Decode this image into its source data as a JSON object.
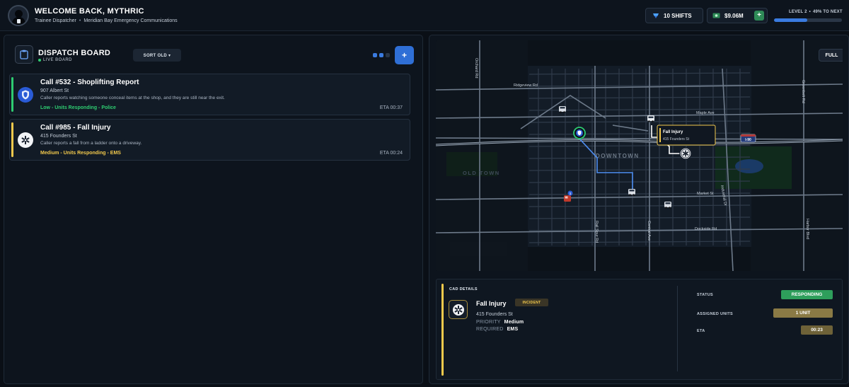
{
  "header": {
    "welcome": "WELCOME BACK, MYTHRIC",
    "role": "Trainee Dispatcher",
    "org": "Meridian Bay Emergency Communications",
    "shifts": "10 SHIFTS",
    "money": "$9.06M",
    "money_add_label": "+",
    "level": "LEVEL 2",
    "level_progress_text": "49% TO NEXT",
    "level_progress": 0.49
  },
  "board": {
    "title": "DISPATCH BOARD",
    "subtitle": "LIVE BOARD",
    "sort_label": "SORT OLD ▾",
    "add_label": "+",
    "calls": [
      {
        "title": "Call #532 - Shoplifting Report",
        "address": "907 Albert St",
        "description": "Caller reports watching someone conceal items at the shop, and they are still near the exit.",
        "status": "Low - Units Responding - Police",
        "eta": "ETA 00:37",
        "color": "#2ecc71",
        "icon": "police-badge-icon"
      },
      {
        "title": "Call #985 - Fall Injury",
        "address": "415 Founders St",
        "description": "Caller reports a fall from a ladder onto a driveway.",
        "status": "Medium - Units Responding - EMS",
        "eta": "ETA 00:24",
        "color": "#f2c94c",
        "icon": "ems-star-icon"
      }
    ]
  },
  "map": {
    "full_label": "FULL",
    "streets": [
      "Orchard Rd",
      "Ridgeview Rd",
      "Maple Ave",
      "Greenbelt Rd",
      "Market St",
      "Industrial Dr",
      "Dockside Rd",
      "Harbor Blvd",
      "Central Ave",
      "Rail Spur Rd"
    ],
    "districts": [
      "DOWNTOWN",
      "OLD TOWN"
    ],
    "highway_label": "I-90",
    "unit_badge": "1",
    "popup": {
      "title": "Fall Injury",
      "address": "415 Founders St"
    }
  },
  "cad": {
    "label": "CAD DETAILS",
    "title": "Fall Injury",
    "tag": "INCIDENT",
    "address": "415 Founders St",
    "priority_label": "PRIORITY",
    "priority": "Medium",
    "required_label": "REQUIRED",
    "required": "EMS",
    "status_label": "STATUS",
    "status": "RESPONDING",
    "units_label": "ASSIGNED UNITS",
    "units": "1 UNIT",
    "eta_label": "ETA",
    "eta": "00:23",
    "colors": {
      "status": "#2e9e5b",
      "units": "#8a7a45",
      "eta": "#6e6238",
      "accent": "#f2c94c"
    }
  }
}
